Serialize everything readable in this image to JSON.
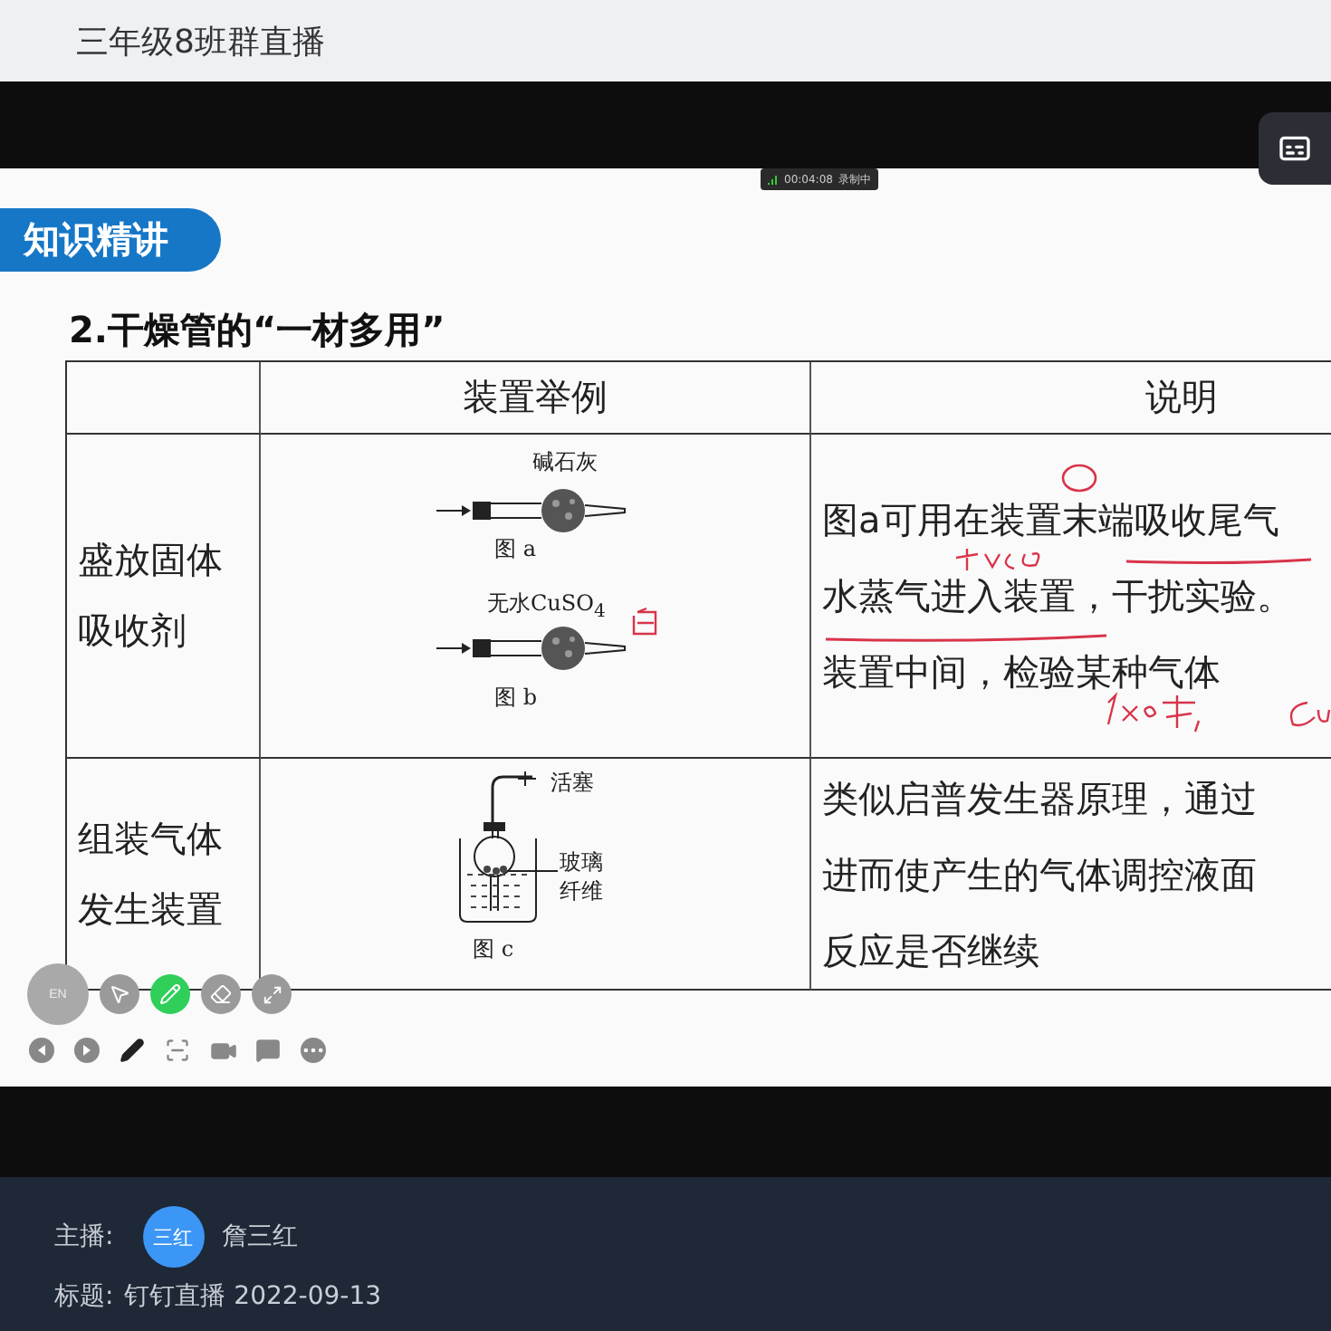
{
  "header": {
    "title": "三年级8班群直播"
  },
  "recording": {
    "time": "00:04:08",
    "status": "录制中"
  },
  "slide": {
    "badge": "知识精讲",
    "heading": "2.干燥管的“一材多用”",
    "table": {
      "columns": [
        "",
        "装置举例",
        "说明"
      ],
      "rows": [
        {
          "label": [
            "盛放固体",
            "吸收剂"
          ],
          "figure": {
            "kind": "tubes",
            "labels": [
              "碱石灰",
              "图 a",
              "无水CuSO$_{4}$",
              "图 b"
            ]
          },
          "lines": [
            "图a可用在装置末端吸收尾气",
            "水蒸气进入装置，干扰实验。",
            "装置中间，检验某种气体"
          ]
        },
        {
          "label": [
            "组装气体",
            "发生装置"
          ],
          "figure": {
            "kind": "generator",
            "labels": [
              "活塞",
              "玻璃",
              "纤维",
              "图 c"
            ]
          },
          "lines": [
            "类似启普发生器原理，通过",
            "进而使产生的气体调控液面",
            "反应是否继续"
          ]
        }
      ]
    }
  },
  "toolbar": {
    "tools": [
      {
        "kind": "lang",
        "label": "EN"
      },
      {
        "kind": "pointer",
        "selected": false
      },
      {
        "kind": "pen",
        "selected": true
      },
      {
        "kind": "eraser",
        "selected": false
      },
      {
        "kind": "expand",
        "selected": false
      }
    ],
    "controls": [
      {
        "kind": "prev"
      },
      {
        "kind": "next"
      },
      {
        "kind": "pen"
      },
      {
        "kind": "capture"
      },
      {
        "kind": "camera"
      },
      {
        "kind": "chat"
      },
      {
        "kind": "more"
      }
    ]
  },
  "footer": {
    "host_label": "主播:",
    "avatar": "三红",
    "host": "詹三红",
    "title_label": "标题:",
    "title": "钉钉直播 2022-09-13"
  }
}
